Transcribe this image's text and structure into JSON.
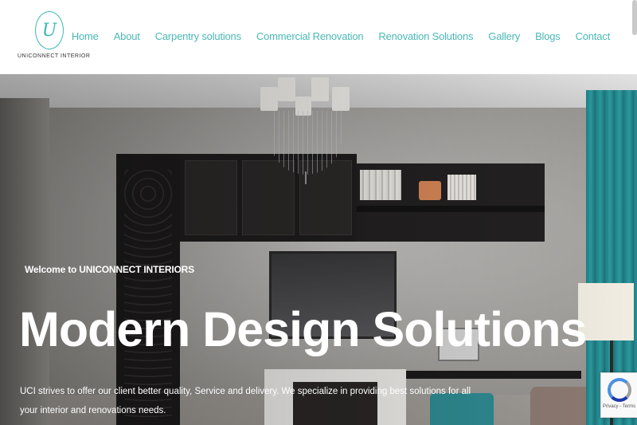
{
  "header": {
    "logo_mark": "U",
    "logo_text": "UNICONNECT INTERIOR"
  },
  "nav": {
    "items": [
      {
        "label": "Home"
      },
      {
        "label": "About"
      },
      {
        "label": "Carpentry solutions"
      },
      {
        "label": "Commercial Renovation"
      },
      {
        "label": "Renovation Solutions"
      },
      {
        "label": "Gallery"
      },
      {
        "label": "Blogs"
      },
      {
        "label": "Contact"
      }
    ]
  },
  "hero": {
    "welcome": "Welcome to UNICONNECT INTERIORS",
    "headline": "Modern Design Solutions",
    "description": "UCI strives to offer our client better quality, Service and delivery. We specialize in providing best solutions for all your interior and renovations needs."
  },
  "recaptcha": {
    "text": "Privacy - Terms",
    "icon": "recaptcha-icon"
  },
  "colors": {
    "accent": "#4ab8b6",
    "hero_text": "#ffffff"
  }
}
